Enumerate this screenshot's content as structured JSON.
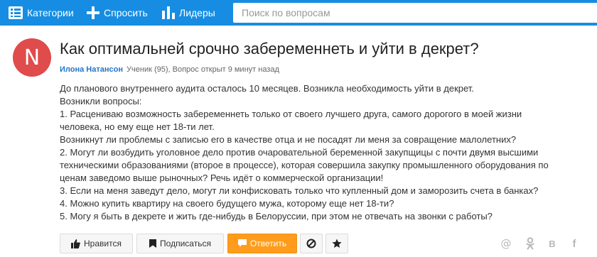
{
  "nav": {
    "categories_label": "Категории",
    "ask_label": "Спросить",
    "leaders_label": "Лидеры",
    "search_placeholder": "Поиск по вопросам"
  },
  "question": {
    "avatar_letter": "N",
    "avatar_color": "#e04b4b",
    "title": "Как оптимальней срочно забеременнеть и уйти в декрет?",
    "author": "Илона Натансон",
    "meta": "Ученик (95), Вопрос открыт 9 минут назад",
    "body": [
      "До планового внутреннего аудита осталось 10 месяцев. Возникла необходимость уйти в декрет.",
      "Возникли вопросы:",
      "1. Расцениваю возможность забеременнеть только от своего лучшего друга, самого дорогого в моей жизни",
      "человека, но ему еще нет 18-ти лет.",
      "Возникнут ли проблемы с записью его в качестве отца и не посадят ли меня за совращение малолетних?",
      "2. Могут ли возбудить уголовное дело против очаровательной беременной закупщицы с почти двумя высшими",
      "техническими образованиями (второе в процессе), которая совершила закупку промышленного оборудования по",
      "ценам заведомо выше рыночных? Речь идёт о коммерческой организации!",
      "3. Если на меня заведут дело, могут ли конфисковать только что купленный дом и заморозить счета в банках?",
      "4. Можно купить квартиру на своего будущего мужа, которому еще нет 18-ти?",
      "5. Могу я быть в декрете и жить где-нибудь в Белоруссии, при этом не отвечать на звонки с работы?"
    ]
  },
  "actions": {
    "like_label": "Нравится",
    "subscribe_label": "Подписаться",
    "answer_label": "Ответить",
    "answer_color": "#ff9c1b"
  },
  "share": {
    "mail_glyph": "@",
    "ok_glyph": "ok",
    "vk_glyph": "В",
    "fb_glyph": "f"
  },
  "colors": {
    "topbar": "#168de2",
    "author_link": "#2375c8"
  }
}
